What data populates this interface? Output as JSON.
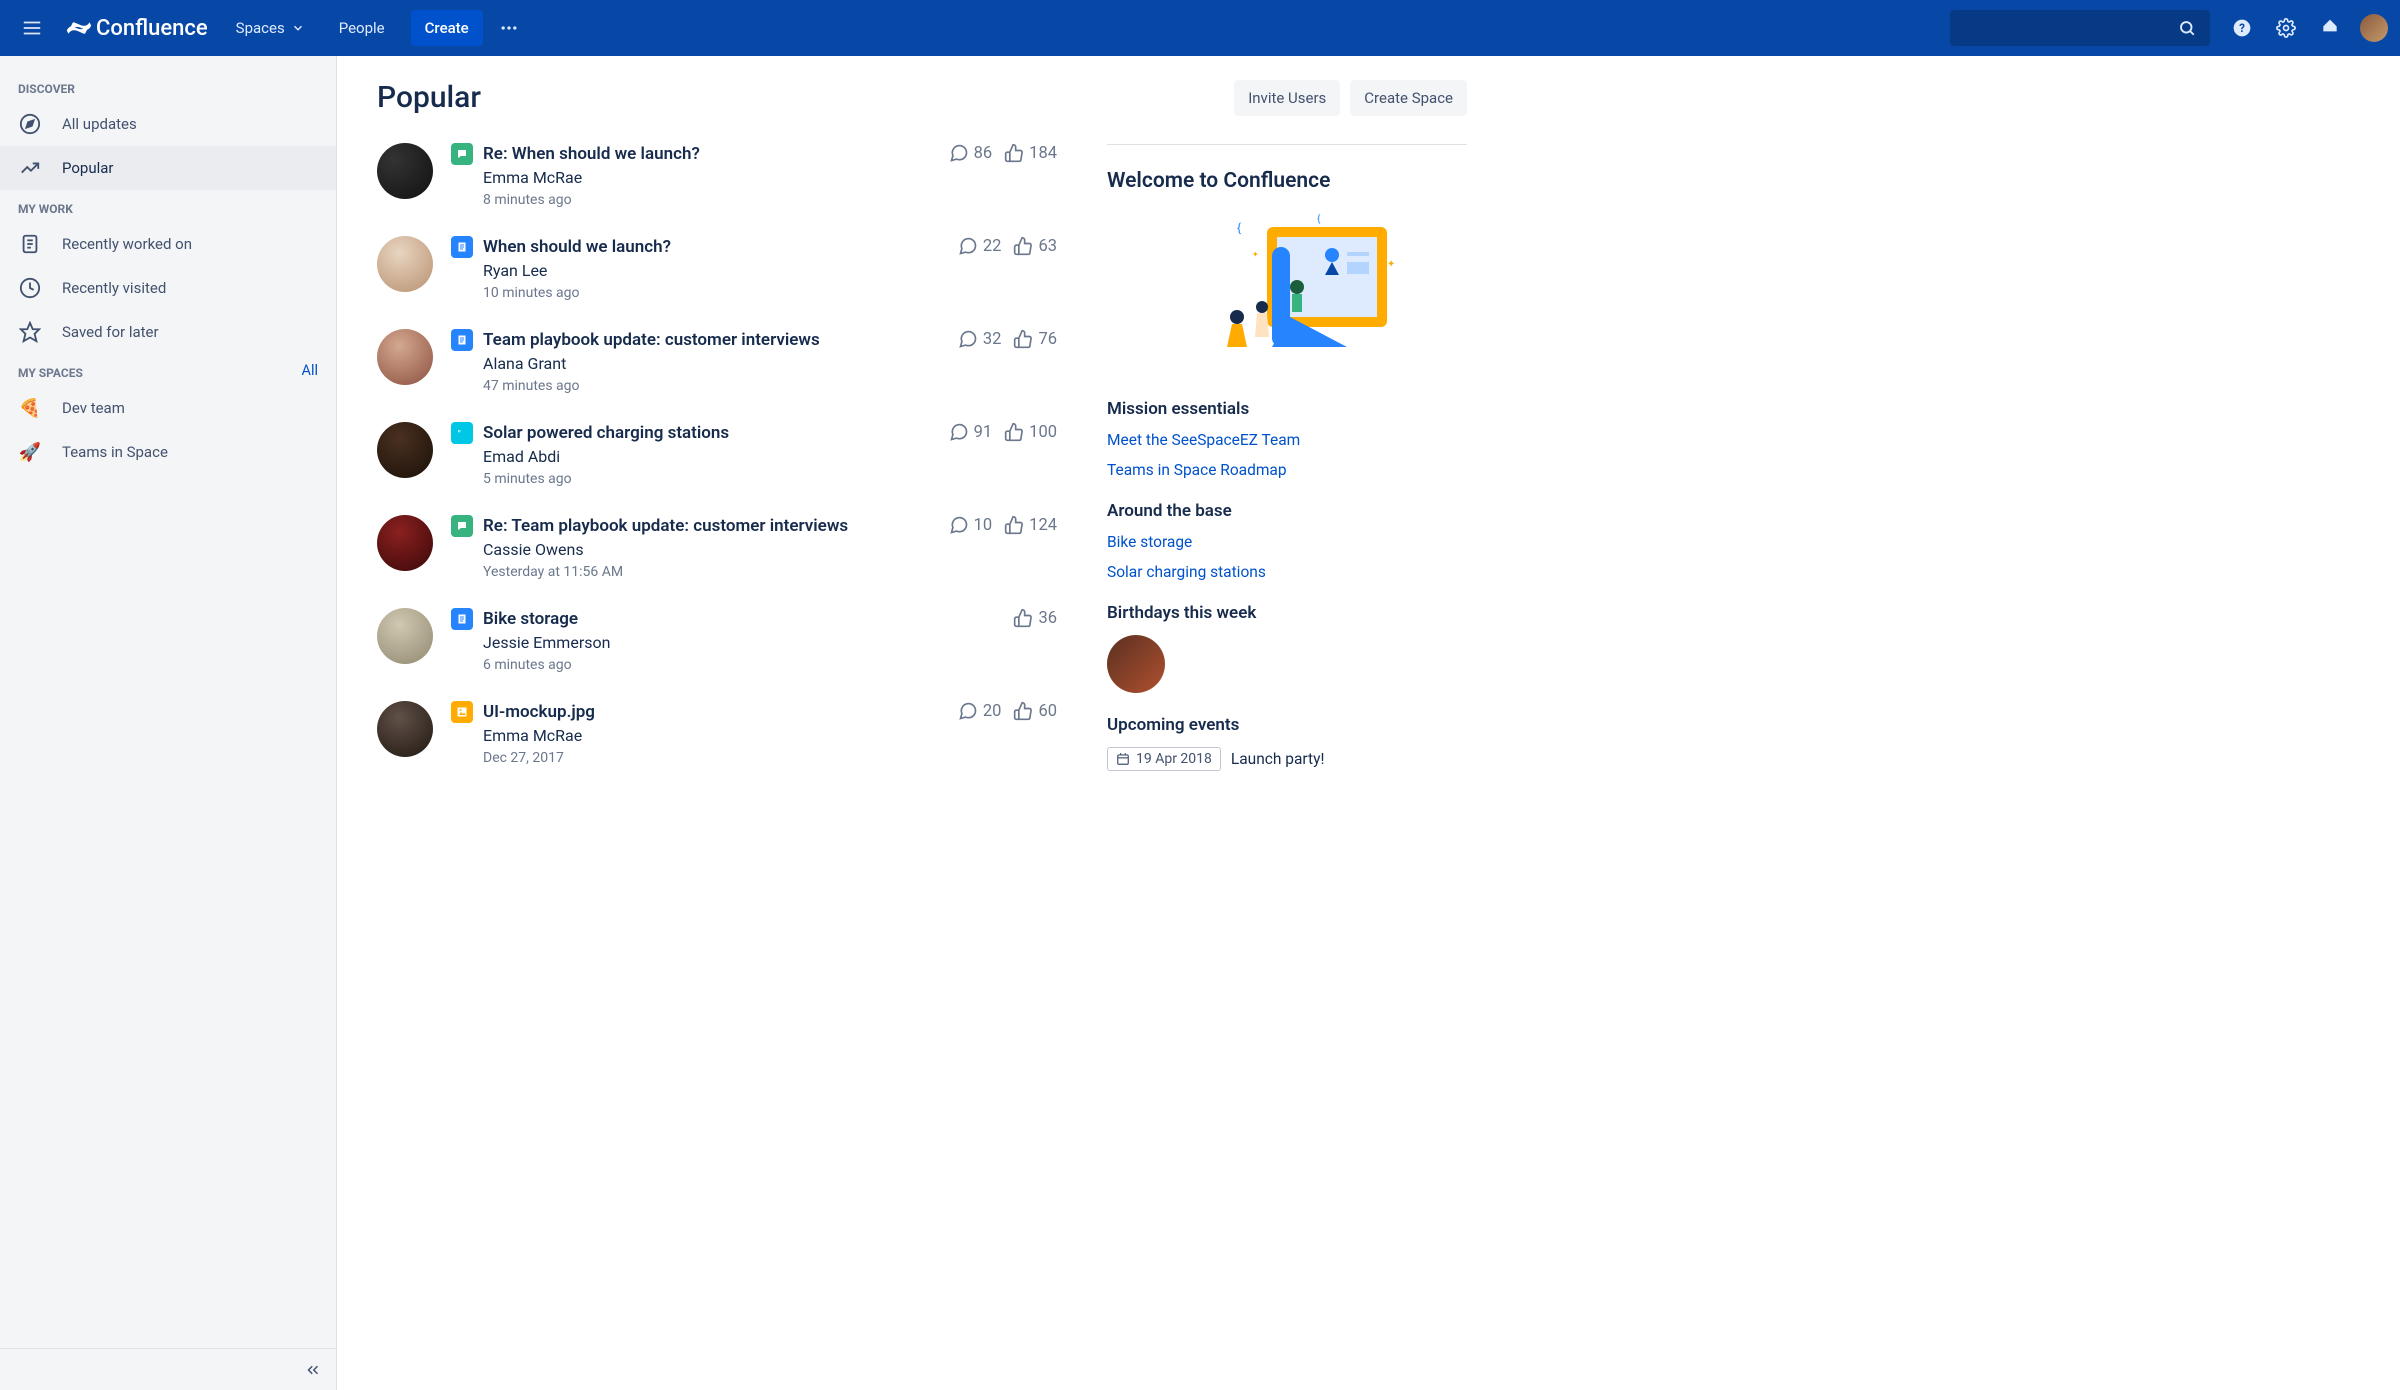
{
  "header": {
    "product": "Confluence",
    "nav": {
      "spaces": "Spaces",
      "people": "People"
    },
    "create": "Create"
  },
  "sidebar": {
    "discover": {
      "label": "DISCOVER",
      "all_updates": "All updates",
      "popular": "Popular"
    },
    "my_work": {
      "label": "MY WORK",
      "recently_worked": "Recently worked on",
      "recently_visited": "Recently visited",
      "saved": "Saved for later"
    },
    "my_spaces": {
      "label": "MY SPACES",
      "all": "All",
      "dev_team": "Dev team",
      "teams_in_space": "Teams in Space"
    }
  },
  "page": {
    "title": "Popular"
  },
  "feed": [
    {
      "type": "comment",
      "title": "Re: When should we launch?",
      "author": "Emma McRae",
      "time": "8 minutes ago",
      "comments": "86",
      "likes": "184"
    },
    {
      "type": "page",
      "title": "When should we launch?",
      "author": "Ryan Lee",
      "time": "10 minutes ago",
      "comments": "22",
      "likes": "63"
    },
    {
      "type": "page",
      "title": "Team playbook update: customer interviews",
      "author": "Alana Grant",
      "time": "47 minutes ago",
      "comments": "32",
      "likes": "76"
    },
    {
      "type": "quote",
      "title": "Solar powered charging stations",
      "author": "Emad Abdi",
      "time": "5 minutes ago",
      "comments": "91",
      "likes": "100"
    },
    {
      "type": "comment",
      "title": "Re: Team playbook update: customer interviews",
      "author": "Cassie Owens",
      "time": "Yesterday at 11:56 AM",
      "comments": "10",
      "likes": "124"
    },
    {
      "type": "page",
      "title": "Bike storage",
      "author": "Jessie Emmerson",
      "time": "6 minutes ago",
      "comments": "",
      "likes": "36"
    },
    {
      "type": "image",
      "title": "UI-mockup.jpg",
      "author": "Emma McRae",
      "time": "Dec 27, 2017",
      "comments": "20",
      "likes": "60"
    }
  ],
  "actions": {
    "invite": "Invite Users",
    "create_space": "Create Space"
  },
  "welcome": {
    "title": "Welcome to Confluence",
    "sections": {
      "mission": {
        "heading": "Mission essentials",
        "links": [
          "Meet the SeeSpaceEZ Team",
          "Teams in Space Roadmap"
        ]
      },
      "around": {
        "heading": "Around the base",
        "links": [
          "Bike storage",
          "Solar charging stations"
        ]
      },
      "birthdays": {
        "heading": "Birthdays this week"
      },
      "events": {
        "heading": "Upcoming events",
        "date": "19 Apr 2018",
        "label": "Launch party!"
      }
    }
  }
}
